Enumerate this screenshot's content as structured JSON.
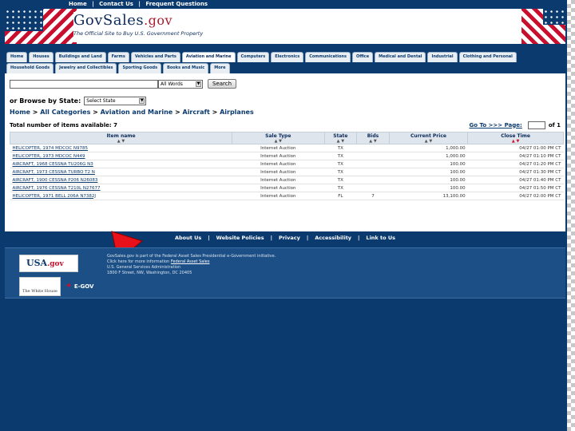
{
  "topnav": {
    "home": "Home",
    "sep1": "|",
    "contact": "Contact Us",
    "sep2": "|",
    "faq": "Frequent Questions"
  },
  "banner": {
    "title_main": "GovSales",
    "title_gov": ".gov",
    "subtitle": "The Official Site to Buy U.S. Government Property"
  },
  "tabs_row1": [
    "Home",
    "Houses",
    "Buildings and Land",
    "Farms",
    "Vehicles and Parts",
    "Aviation and Marine",
    "Computers",
    "Electronics",
    "Communications",
    "Office",
    "Medical and Dental",
    "Industrial",
    "Clothing and Personal"
  ],
  "tabs_row2": [
    "Household Goods",
    "Jewelry and Collectibles",
    "Sporting Goods",
    "Books and Music",
    "More"
  ],
  "search": {
    "match_select": "All Words",
    "button": "Search",
    "browse_label": "or Browse by State:",
    "state_select": "Select State"
  },
  "breadcrumb": {
    "home": "Home",
    "cat": "All Categories",
    "aviation": "Aviation and Marine",
    "aircraft": "Aircraft",
    "current": "Airplanes",
    "sep": ">"
  },
  "results": {
    "count_label": "Total number of items available: 7",
    "goto": "Go To >>> Page:",
    "of": "of 1",
    "headers": [
      "Item name",
      "Sale Type",
      "State",
      "Bids",
      "Current Price",
      "Close Time"
    ],
    "sort_glyph": "▲ ▼",
    "rows": [
      {
        "name": "HELICOPTER, 1974 MDCOC N9785",
        "type": "Internet Auction",
        "state": "TX",
        "bids": "",
        "price": "1,000.00",
        "close": "04/27 01:00 PM CT"
      },
      {
        "name": "HELICOPTER, 1973 MDCOC N449",
        "type": "Internet Auction",
        "state": "TX",
        "bids": "",
        "price": "1,000.00",
        "close": "04/27 01:10 PM CT"
      },
      {
        "name": "AIRCRAFT, 1968 CESSNA TU206G N3",
        "type": "Internet Auction",
        "state": "TX",
        "bids": "",
        "price": "100.00",
        "close": "04/27 01:20 PM CT"
      },
      {
        "name": "AIRCRAFT, 1973 CESSNA TURBO T2 N",
        "type": "Internet Auction",
        "state": "TX",
        "bids": "",
        "price": "100.00",
        "close": "04/27 01:30 PM CT"
      },
      {
        "name": "AIRCRAFT, 1900 CESSNA P206 N26083",
        "type": "Internet Auction",
        "state": "TX",
        "bids": "",
        "price": "100.00",
        "close": "04/27 01:40 PM CT"
      },
      {
        "name": "AIRCRAFT, 1976 CESSNA T210L N27677",
        "type": "Internet Auction",
        "state": "TX",
        "bids": "",
        "price": "100.00",
        "close": "04/27 01:50 PM CT"
      },
      {
        "name": "HELICOPTER, 1971 BELL 206A N7382J",
        "type": "Internet Auction",
        "state": "FL",
        "bids": "7",
        "price": "13,100.00",
        "close": "04/27 02:00 PM CT"
      }
    ]
  },
  "footer": {
    "links": [
      "About Us",
      "Website Policies",
      "Privacy",
      "Accessibility",
      "Link to Us"
    ],
    "link_sep": "|",
    "usa_main": "USA",
    "usa_gov": ".gov",
    "whitehouse": "The White House",
    "egov": "E-GOV",
    "line1": "GovSales.gov is part of the Federal Asset Sales Presidential e-Government initiative.",
    "line2_pre": "Click here for more information",
    "line2_link": "Federal Asset Sales",
    "line3": "U.S. General Services Administration",
    "line4": "1800 F Street, NW, Washington, DC 20405"
  },
  "colors": {
    "navy": "#0b3a6e",
    "red": "#c8102e",
    "header_bg": "#dfe5ec"
  }
}
